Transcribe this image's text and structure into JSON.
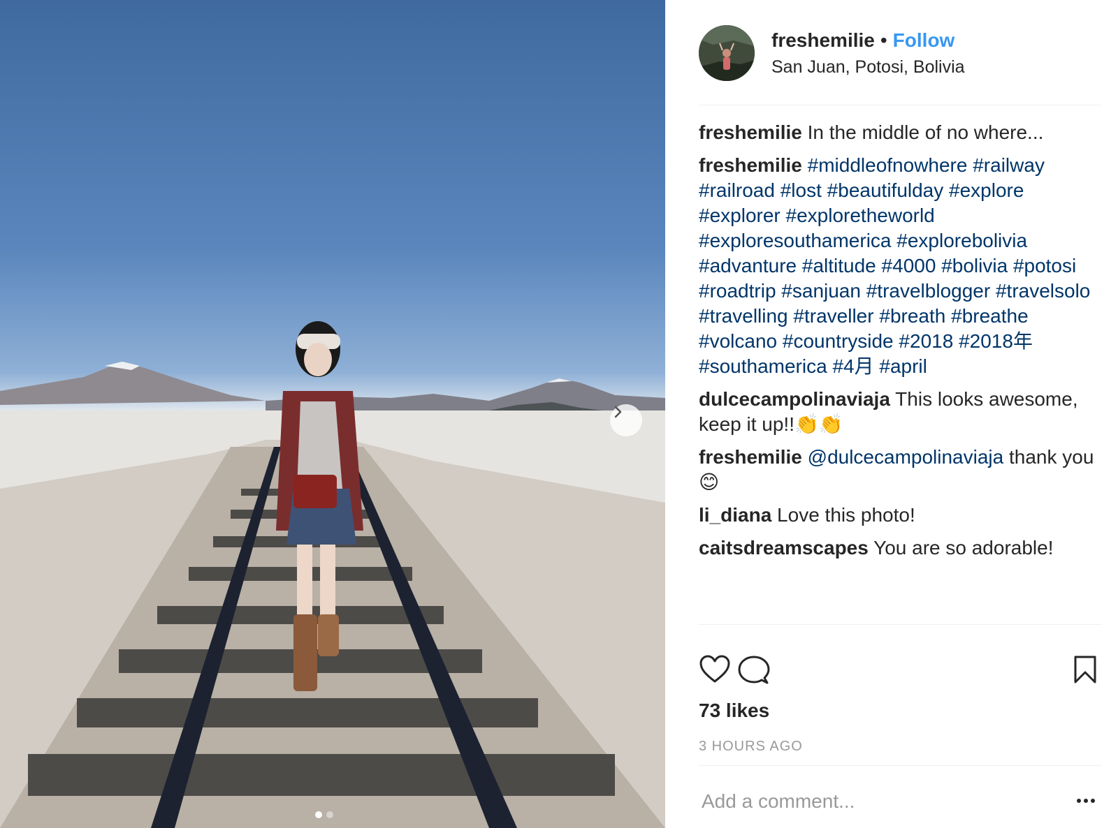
{
  "post": {
    "username": "freshemilie",
    "separator": "•",
    "follow_label": "Follow",
    "location": "San Juan, Potosi, Bolivia"
  },
  "comments": [
    {
      "user": "freshemilie",
      "text": "In the middle of no where...",
      "tags": []
    },
    {
      "user": "freshemilie",
      "text": "",
      "tags": [
        "#middleofnowhere",
        "#railway",
        "#railroad",
        "#lost",
        "#beautifulday",
        "#explore",
        "#explorer",
        "#exploretheworld",
        "#exploresouthamerica",
        "#explorebolivia",
        "#advanture",
        "#altitude",
        "#4000",
        "#bolivia",
        "#potosi",
        "#roadtrip",
        "#sanjuan",
        "#travelblogger",
        "#travelsolo",
        "#travelling",
        "#traveller",
        "#breath",
        "#breathe",
        "#volcano",
        "#countryside",
        "#2018",
        "#2018年",
        "#southamerica",
        "#4月",
        "#april"
      ]
    },
    {
      "user": "dulcecampolinaviaja",
      "text": "This looks awesome, keep it up!!👏👏",
      "tags": []
    },
    {
      "user": "freshemilie",
      "mention": "@dulcecampolinaviaja",
      "text": "thank you 😊",
      "tags": []
    },
    {
      "user": "li_diana",
      "text": "Love this photo!",
      "tags": []
    },
    {
      "user": "caitsdreamscapes",
      "text": "You are so adorable!",
      "tags": []
    }
  ],
  "stats": {
    "likes": "73 likes",
    "time": "3 HOURS AGO"
  },
  "input": {
    "placeholder": "Add a comment..."
  },
  "icons": {
    "like": "heart-icon",
    "comment": "comment-bubble-icon",
    "save": "bookmark-icon",
    "more": "more-options-icon",
    "next": "chevron-right-icon"
  },
  "carousel": {
    "slides": 2,
    "active": 1
  },
  "colors": {
    "link": "#3897f0",
    "hashtag": "#003569",
    "muted": "#999999",
    "divider": "#efefef"
  }
}
